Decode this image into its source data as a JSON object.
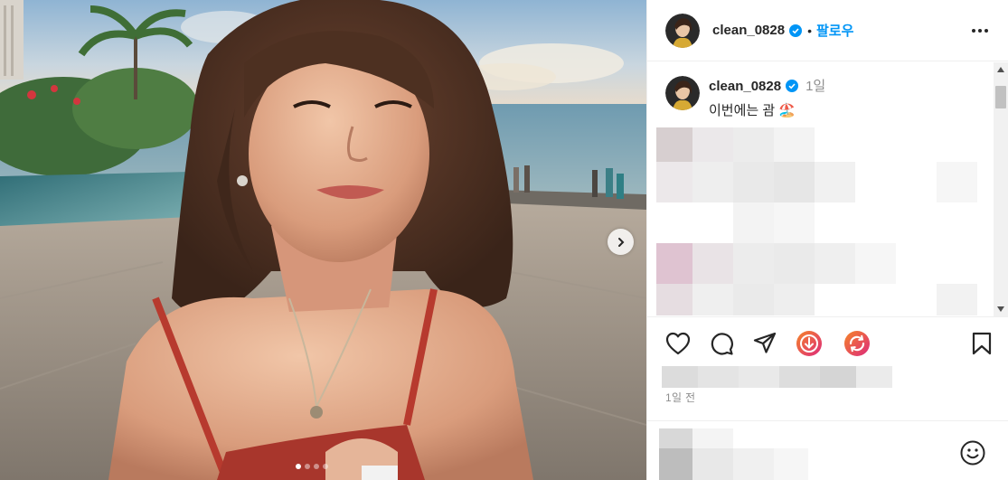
{
  "post": {
    "username": "clean_0828",
    "follow_label": "팔로우",
    "separator": "•",
    "caption_time": "1일",
    "caption_text": "이번에는 괌 ",
    "caption_emoji": "🏖️",
    "date": "1일 전"
  },
  "carousel": {
    "current_slide": 1,
    "total_slides": 4
  },
  "icons": {
    "verified": "verified-badge-icon",
    "more": "more-options-icon",
    "like": "heart-icon",
    "comment": "comment-icon",
    "share": "send-icon",
    "download": "download-icon",
    "repost": "repost-icon",
    "save": "bookmark-icon",
    "emoji": "emoji-icon",
    "next": "chevron-right-icon"
  },
  "colors": {
    "accent": "#0095f6",
    "verified": "#0095f6",
    "text": "#262626",
    "muted": "#8e8e8e",
    "download_gradient": [
      "#f58529",
      "#dd2a7b"
    ]
  }
}
